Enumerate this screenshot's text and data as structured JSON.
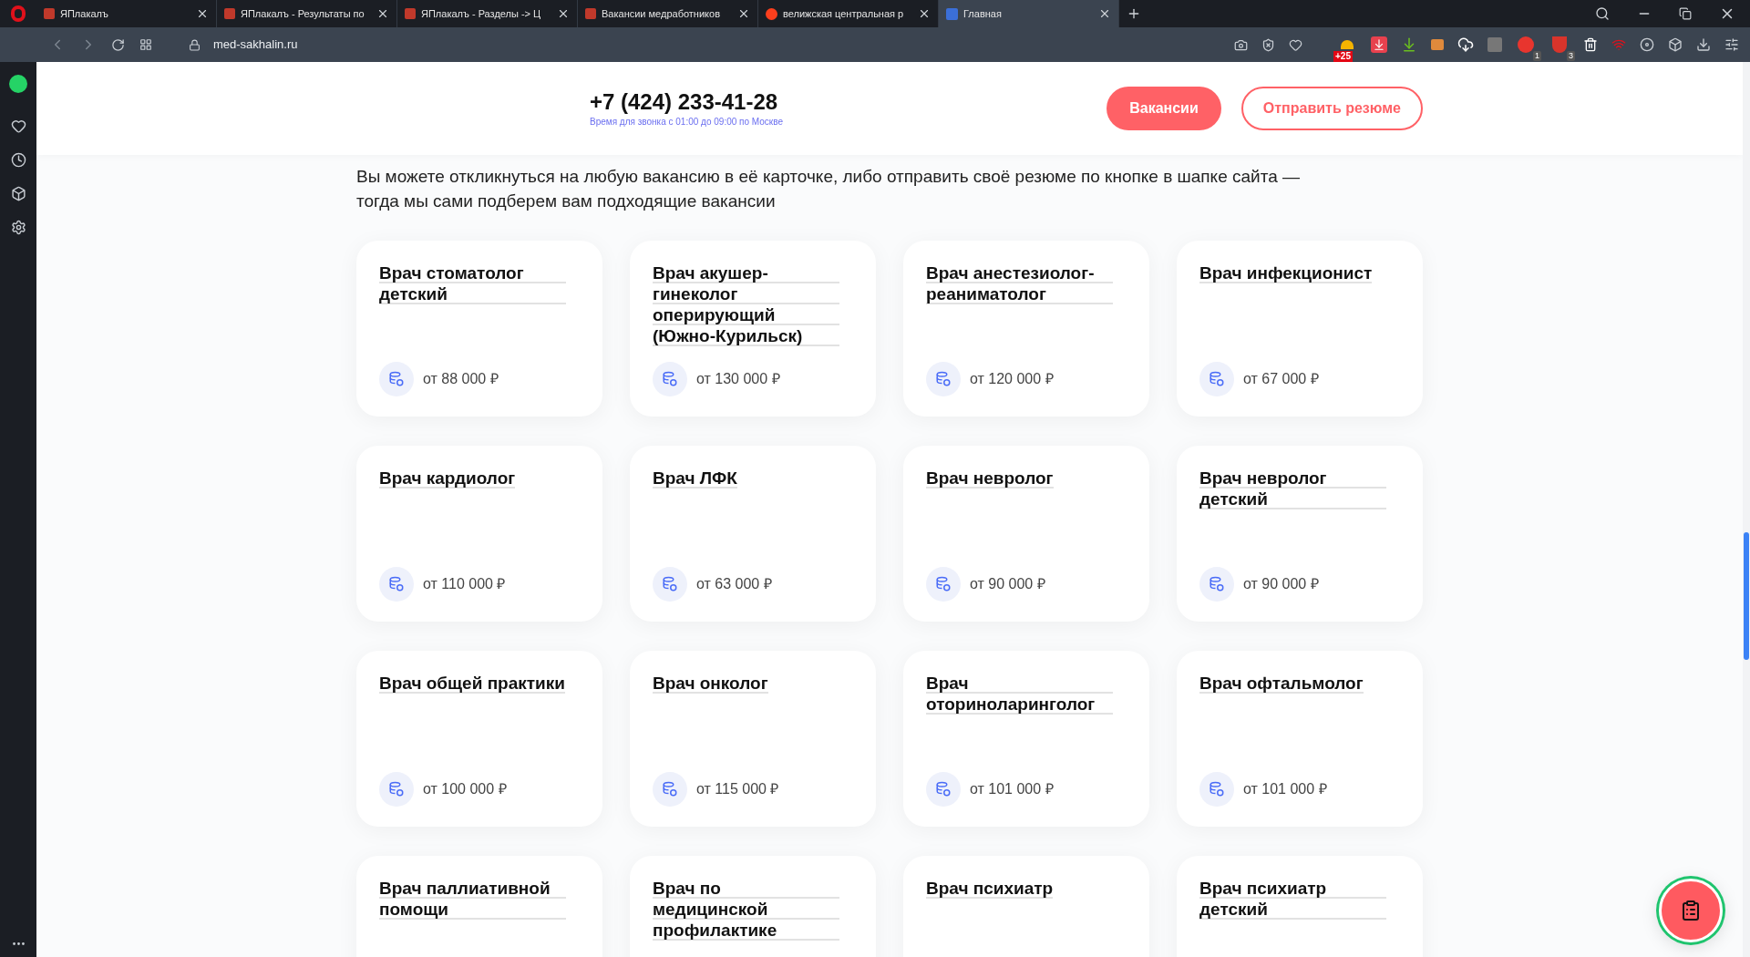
{
  "browser": {
    "tabs": [
      {
        "title": "ЯПлакалъ",
        "selected": false,
        "kind": "yap"
      },
      {
        "title": "ЯПлакалъ - Результаты по",
        "selected": false,
        "kind": "yap"
      },
      {
        "title": "ЯПлакалъ - Разделы -> Ц",
        "selected": false,
        "kind": "yap"
      },
      {
        "title": "Вакансии медработников",
        "selected": false,
        "kind": "yap"
      },
      {
        "title": "велижская центральная р",
        "selected": false,
        "kind": "yandex"
      },
      {
        "title": "Главная",
        "selected": true,
        "kind": "site"
      }
    ],
    "address": "med-sakhalin.ru",
    "extension_badges": [
      {
        "kind": "weather",
        "badge": "+25"
      },
      {
        "kind": "abp",
        "badge": "1"
      },
      {
        "kind": "shield",
        "badge": "3"
      }
    ]
  },
  "header": {
    "phone": "+7 (424) 233-41-28",
    "call_hours": "Время для звонка с 01:00 до 09:00 по Москве",
    "buttons": [
      {
        "label": "Вакансии",
        "kind": "filled"
      },
      {
        "label": "Отправить резюме",
        "kind": "outline"
      }
    ]
  },
  "intro": "Вы можете откликнуться на любую вакансию в её карточке, либо отправить своё резюме по кнопке в шапке сайта — тогда мы сами подберем вам подходящие вакансии",
  "vacancies": [
    {
      "title": "Врач стоматолог детский",
      "salary": "от 88 000 ₽"
    },
    {
      "title": "Врач акушер-гинеколог оперирующий (Южно-Курильск)",
      "salary": "от 130 000 ₽"
    },
    {
      "title": "Врач анестезиолог-реаниматолог",
      "salary": "от 120 000 ₽"
    },
    {
      "title": "Врач инфекционист",
      "salary": "от 67 000 ₽"
    },
    {
      "title": "Врач кардиолог",
      "salary": "от 110 000 ₽"
    },
    {
      "title": "Врач ЛФК",
      "salary": "от 63 000 ₽"
    },
    {
      "title": "Врач невролог",
      "salary": "от 90 000 ₽"
    },
    {
      "title": "Врач невролог детский",
      "salary": "от 90 000 ₽"
    },
    {
      "title": "Врач общей практики",
      "salary": "от 100 000 ₽"
    },
    {
      "title": "Врач онколог",
      "salary": "от 115 000 ₽"
    },
    {
      "title": "Врач оториноларинголог",
      "salary": "от 101 000 ₽"
    },
    {
      "title": "Врач офтальмолог",
      "salary": "от 101 000 ₽"
    },
    {
      "title": "Врач паллиативной помощи"
    },
    {
      "title": "Врач по медицинской профилактике"
    },
    {
      "title": "Врач психиатр"
    },
    {
      "title": "Врач психиатр детский"
    }
  ]
}
